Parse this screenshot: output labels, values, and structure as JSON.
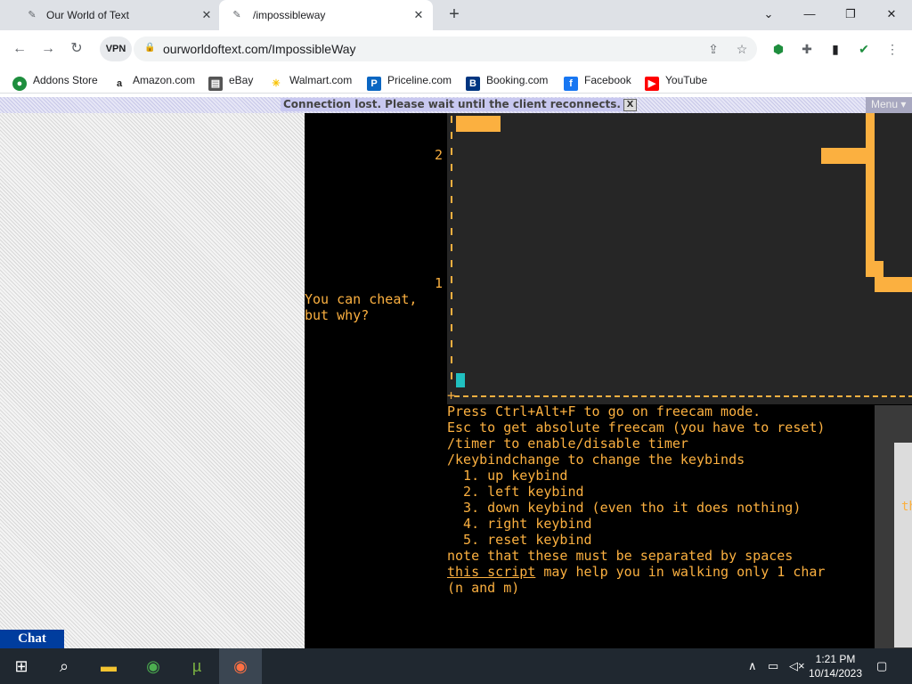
{
  "browser": {
    "tabs": [
      {
        "title": "Our World of Text",
        "icon": "owot-icon"
      },
      {
        "title": "/impossibleway",
        "icon": "owot-icon"
      }
    ],
    "url": "ourworldoftext.com/ImpossibleWay",
    "vpn_label": "VPN",
    "bookmarks": [
      {
        "label": "Addons Store",
        "color": "#1e8e3e"
      },
      {
        "label": "Amazon.com",
        "color": "#222222"
      },
      {
        "label": "eBay",
        "color": "#333333"
      },
      {
        "label": "Walmart.com",
        "color": "#f8c200"
      },
      {
        "label": "Priceline.com",
        "color": "#0a66c2"
      },
      {
        "label": "Booking.com",
        "color": "#003580"
      },
      {
        "label": "Facebook",
        "color": "#1877f2"
      },
      {
        "label": "YouTube",
        "color": "#ff0000"
      }
    ]
  },
  "page": {
    "connection_message": "Connection lost. Please wait until the client reconnects.",
    "connection_close": "X",
    "menu_label": "Menu",
    "menu_arrow": "▾",
    "axis_labels": [
      "2",
      "1"
    ],
    "cheat_text": "You can cheat,\nbut why?",
    "notes": [
      "Press Ctrl+Alt+F to go on freecam mode.",
      "Esc to get absolute freecam (you have to reset)",
      "/timer to enable/disable timer",
      "/keybindchange to change the keybinds",
      "  1. up keybind",
      "  2. left keybind",
      "  3. down keybind (even tho it does nothing)",
      "  4. right keybind",
      "  5. reset keybind",
      "note that these must be separated by spaces"
    ],
    "script_link": "this script",
    "script_rest": " may help you in walking only 1 char",
    "script_tail": "(n and m)",
    "right_fragment": "th",
    "chat_label": "Chat"
  },
  "taskbar": {
    "time": "1:21 PM",
    "date": "10/14/2023"
  },
  "colors": {
    "accent_orange": "#fbb040",
    "cursor_cyan": "#20c0c0",
    "chat_blue": "#003d9e"
  }
}
